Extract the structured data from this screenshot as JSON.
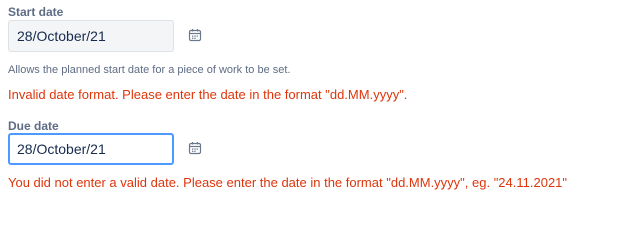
{
  "start_date": {
    "label": "Start date",
    "value": "28/October/21",
    "help": "Allows the planned start date for a piece of work to be set.",
    "error": "Invalid date format. Please enter the date in the format \"dd.MM.yyyy\"."
  },
  "due_date": {
    "label": "Due date",
    "value": "28/October/21",
    "error": "You did not enter a valid date. Please enter the date in the format \"dd.MM.yyyy\", eg. \"24.11.2021\""
  },
  "icons": {
    "calendar": "calendar-icon"
  },
  "colors": {
    "error": "#de350b",
    "focus_border": "#4c9aff",
    "label": "#5e6c84"
  }
}
